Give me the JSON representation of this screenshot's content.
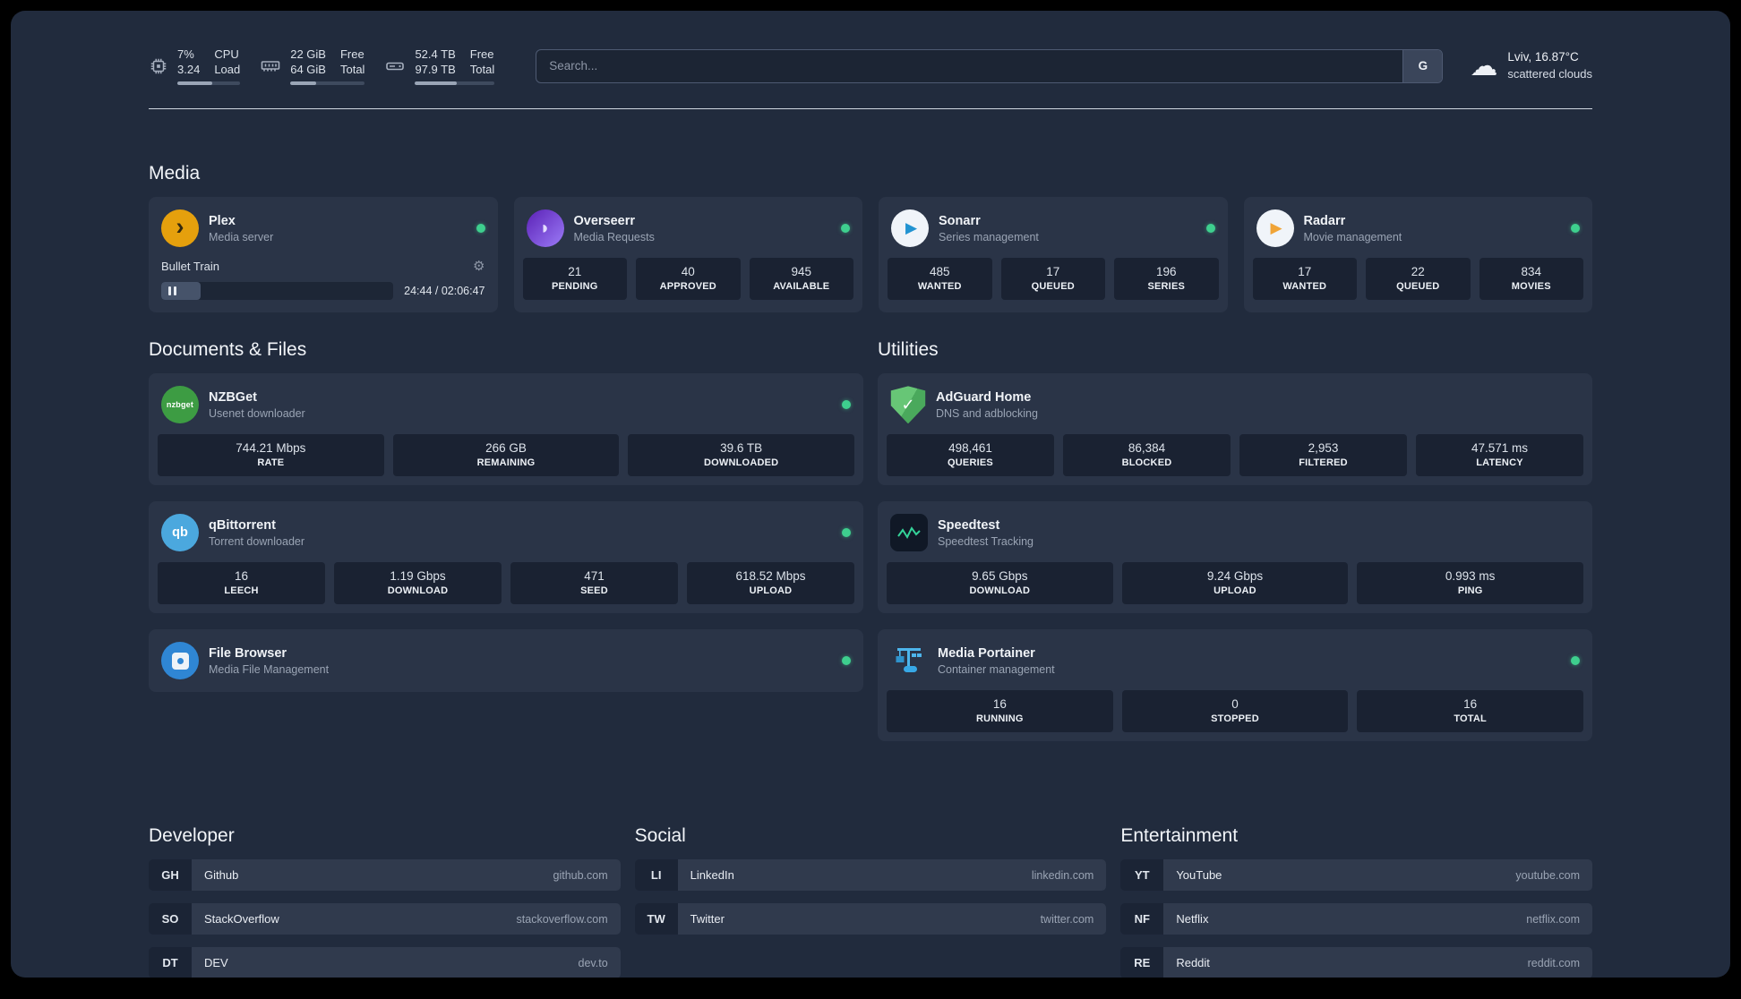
{
  "topbar": {
    "resources": [
      {
        "icon": "cpu-icon",
        "col1": [
          "7%",
          "3.24"
        ],
        "col2": [
          "CPU",
          "Load"
        ],
        "progress": 55
      },
      {
        "icon": "memory-icon",
        "col1": [
          "22 GiB",
          "64 GiB"
        ],
        "col2": [
          "Free",
          "Total"
        ],
        "progress": 35
      },
      {
        "icon": "disk-icon",
        "col1": [
          "52.4 TB",
          "97.9 TB"
        ],
        "col2": [
          "Free",
          "Total"
        ],
        "progress": 53
      }
    ],
    "search": {
      "placeholder": "Search...",
      "provider_label": "G"
    },
    "weather": {
      "location": "Lviv, 16.87°C",
      "condition": "scattered clouds"
    }
  },
  "media": {
    "title": "Media",
    "services": [
      {
        "name": "Plex",
        "subtitle": "Media server",
        "status": "online",
        "player": {
          "track_title": "Bullet Train",
          "time": "24:44 / 02:06:47",
          "progress": 17
        }
      },
      {
        "name": "Overseerr",
        "subtitle": "Media Requests",
        "status": "online",
        "stats": [
          {
            "value": "21",
            "label": "PENDING"
          },
          {
            "value": "40",
            "label": "APPROVED"
          },
          {
            "value": "945",
            "label": "AVAILABLE"
          }
        ]
      },
      {
        "name": "Sonarr",
        "subtitle": "Series management",
        "status": "online",
        "stats": [
          {
            "value": "485",
            "label": "WANTED"
          },
          {
            "value": "17",
            "label": "QUEUED"
          },
          {
            "value": "196",
            "label": "SERIES"
          }
        ]
      },
      {
        "name": "Radarr",
        "subtitle": "Movie management",
        "status": "online",
        "stats": [
          {
            "value": "17",
            "label": "WANTED"
          },
          {
            "value": "22",
            "label": "QUEUED"
          },
          {
            "value": "834",
            "label": "MOVIES"
          }
        ]
      }
    ]
  },
  "documents": {
    "title": "Documents & Files",
    "services": [
      {
        "name": "NZBGet",
        "subtitle": "Usenet downloader",
        "status": "online",
        "stats": [
          {
            "value": "744.21 Mbps",
            "label": "RATE"
          },
          {
            "value": "266 GB",
            "label": "REMAINING"
          },
          {
            "value": "39.6 TB",
            "label": "DOWNLOADED"
          }
        ]
      },
      {
        "name": "qBittorrent",
        "subtitle": "Torrent downloader",
        "status": "online",
        "stats": [
          {
            "value": "16",
            "label": "LEECH"
          },
          {
            "value": "1.19 Gbps",
            "label": "DOWNLOAD"
          },
          {
            "value": "471",
            "label": "SEED"
          },
          {
            "value": "618.52 Mbps",
            "label": "UPLOAD"
          }
        ]
      },
      {
        "name": "File Browser",
        "subtitle": "Media File Management",
        "status": "online"
      }
    ]
  },
  "utilities": {
    "title": "Utilities",
    "services": [
      {
        "name": "AdGuard Home",
        "subtitle": "DNS and adblocking",
        "stats": [
          {
            "value": "498,461",
            "label": "QUERIES"
          },
          {
            "value": "86,384",
            "label": "BLOCKED"
          },
          {
            "value": "2,953",
            "label": "FILTERED"
          },
          {
            "value": "47.571 ms",
            "label": "LATENCY"
          }
        ]
      },
      {
        "name": "Speedtest",
        "subtitle": "Speedtest Tracking",
        "stats": [
          {
            "value": "9.65 Gbps",
            "label": "DOWNLOAD"
          },
          {
            "value": "9.24 Gbps",
            "label": "UPLOAD"
          },
          {
            "value": "0.993 ms",
            "label": "PING"
          }
        ]
      },
      {
        "name": "Media Portainer",
        "subtitle": "Container management",
        "status": "online",
        "stats": [
          {
            "value": "16",
            "label": "RUNNING"
          },
          {
            "value": "0",
            "label": "STOPPED"
          },
          {
            "value": "16",
            "label": "TOTAL"
          }
        ]
      }
    ]
  },
  "bookmarks": [
    {
      "title": "Developer",
      "items": [
        {
          "abbr": "GH",
          "name": "Github",
          "url": "github.com"
        },
        {
          "abbr": "SO",
          "name": "StackOverflow",
          "url": "stackoverflow.com"
        },
        {
          "abbr": "DT",
          "name": "DEV",
          "url": "dev.to"
        }
      ]
    },
    {
      "title": "Social",
      "items": [
        {
          "abbr": "LI",
          "name": "LinkedIn",
          "url": "linkedin.com"
        },
        {
          "abbr": "TW",
          "name": "Twitter",
          "url": "twitter.com"
        }
      ]
    },
    {
      "title": "Entertainment",
      "items": [
        {
          "abbr": "YT",
          "name": "YouTube",
          "url": "youtube.com"
        },
        {
          "abbr": "NF",
          "name": "Netflix",
          "url": "netflix.com"
        },
        {
          "abbr": "RE",
          "name": "Reddit",
          "url": "reddit.com"
        }
      ]
    }
  ]
}
